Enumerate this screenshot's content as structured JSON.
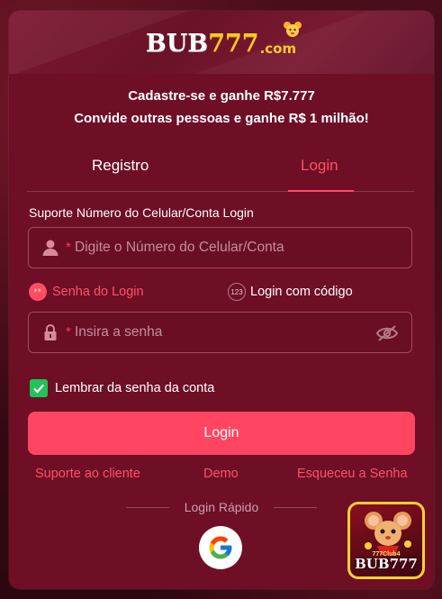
{
  "brand": {
    "logo_main": "BUB",
    "logo_digits": "777",
    "logo_suffix": ".com"
  },
  "promo": {
    "line1": "Cadastre-se e ganhe R$7.777",
    "line2": "Convide outras pessoas e ganhe R$ 1 milhão!"
  },
  "tabs": [
    {
      "label": "Registro",
      "active": false
    },
    {
      "label": "Login",
      "active": true
    }
  ],
  "form": {
    "account_label": "Suporte Número do Celular/Conta Login",
    "account_placeholder": "Digite o Número do Celular/Conta",
    "required_mark": "*",
    "password_placeholder": "Insira a senha",
    "login_mode_password": "Senha do Login",
    "login_mode_code": "Login com código",
    "password_badge": "**",
    "code_badge": "123",
    "remember_label": "Lembrar da senha da conta",
    "remember_checked": true,
    "submit_label": "Login"
  },
  "links": {
    "support": "Suporte ao cliente",
    "demo": "Demo",
    "forgot": "Esqueceu a Senha"
  },
  "quick_login": {
    "label": "Login Rápido",
    "provider_icon": "google-icon"
  },
  "app_badge": {
    "label": "BUB777",
    "sublabel": "777Club4"
  },
  "colors": {
    "modal_bg": "#6e0f26",
    "accent": "#ff4561",
    "checkbox": "#21c35a",
    "logo_gold": "#ffc82a"
  }
}
